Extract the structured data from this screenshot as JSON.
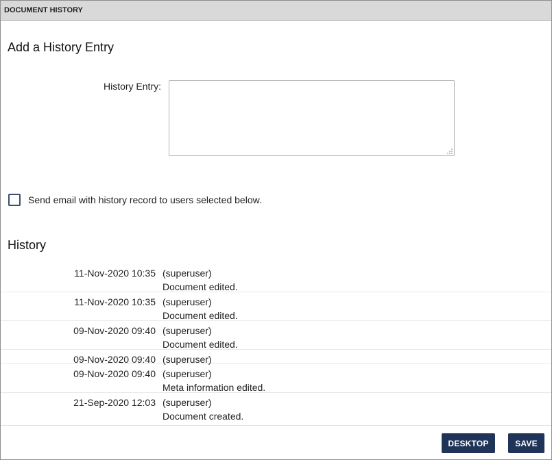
{
  "panel": {
    "title": "DOCUMENT HISTORY"
  },
  "add_entry": {
    "heading": "Add a History Entry",
    "label": "History Entry:",
    "value": "",
    "placeholder": ""
  },
  "email_option": {
    "label": "Send email with history record to users selected below.",
    "checked": false
  },
  "history": {
    "heading": "History",
    "entries": [
      {
        "date": "11-Nov-2020 10:35",
        "user": "(superuser)",
        "action": "Document edited."
      },
      {
        "date": "11-Nov-2020 10:35",
        "user": "(superuser)",
        "action": "Document edited."
      },
      {
        "date": "09-Nov-2020 09:40",
        "user": "(superuser)",
        "action": "Document edited."
      },
      {
        "date": "09-Nov-2020 09:40",
        "user": "(superuser)",
        "action": ""
      },
      {
        "date": "09-Nov-2020 09:40",
        "user": "(superuser)",
        "action": "Meta information edited."
      },
      {
        "date": "21-Sep-2020 12:03",
        "user": "(superuser)",
        "action": "Document created."
      }
    ]
  },
  "footer": {
    "desktop_label": "DESKTOP",
    "save_label": "SAVE"
  },
  "colors": {
    "button_bg": "#1f3458",
    "titlebar_bg": "#d9d9d9"
  }
}
